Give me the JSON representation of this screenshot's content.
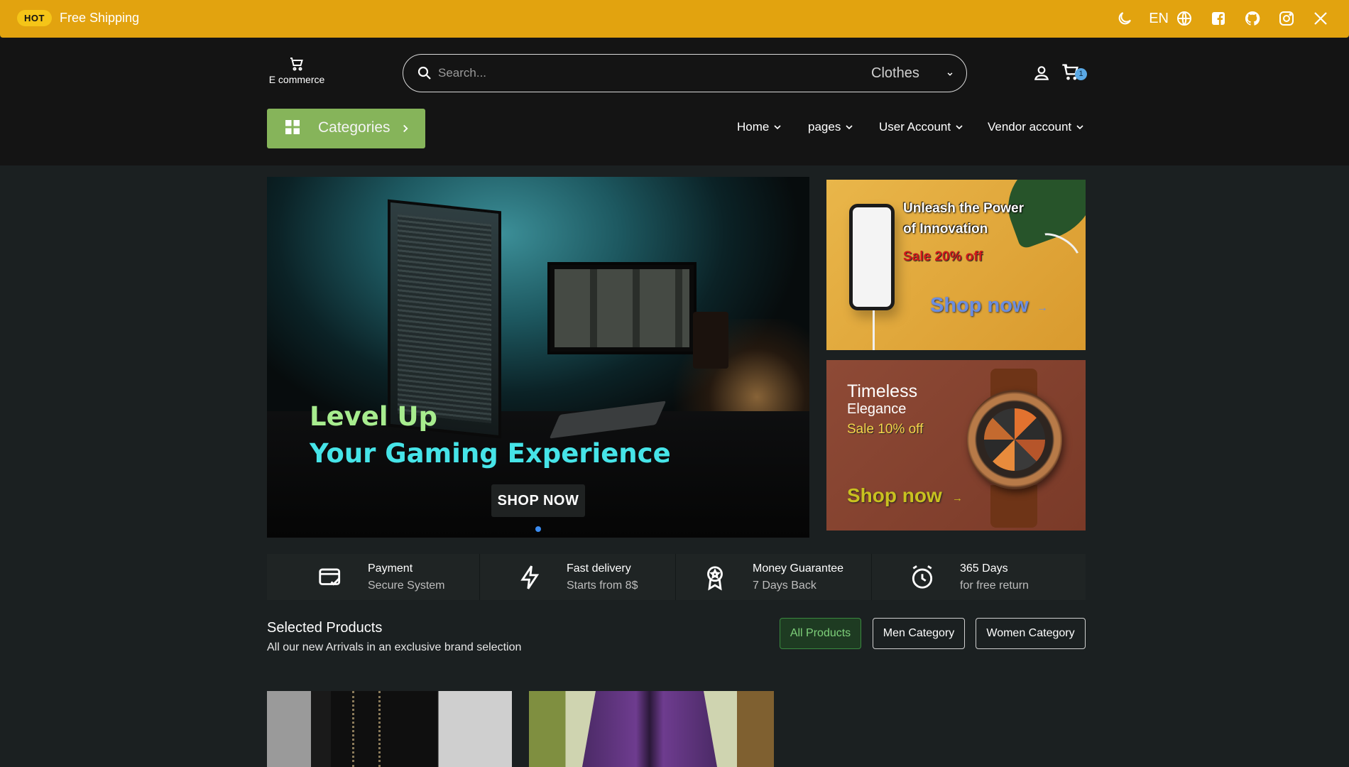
{
  "topbar": {
    "hot_badge": "HOT",
    "shipping_text": "Free Shipping",
    "language": "EN"
  },
  "header": {
    "logo_text": "E commerce",
    "search": {
      "placeholder": "Search...",
      "category": "Clothes"
    },
    "cart_count": "1",
    "categories_label": "Categories",
    "nav": [
      "Home",
      "pages",
      "User Account",
      "Vendor account"
    ]
  },
  "hero": {
    "line1": "Level Up",
    "line2": "Your Gaming Experience",
    "button": "SHOP NOW"
  },
  "promo1": {
    "title": "Unleash the Power of Innovation",
    "sale": "Sale 20% off",
    "shop": "Shop now",
    "arrow": "→"
  },
  "promo2": {
    "title": "Timeless",
    "subtitle": "Elegance",
    "sale": "Sale 10% off",
    "shop": "Shop now",
    "arrow": "→"
  },
  "features": [
    {
      "title": "Payment",
      "subtitle": "Secure System"
    },
    {
      "title": "Fast delivery",
      "subtitle": "Starts from 8$"
    },
    {
      "title": "Money Guarantee",
      "subtitle": "7 Days Back"
    },
    {
      "title": "365 Days",
      "subtitle": "for free return"
    }
  ],
  "selected": {
    "title": "Selected Products",
    "subtitle": "All our new Arrivals in an exclusive brand selection",
    "tabs": [
      "All Products",
      "Men Category",
      "Women Category"
    ]
  },
  "colors": {
    "topbar": "#e2a30f",
    "header": "#141414",
    "page": "#1b2021",
    "categories": "#86b45a",
    "active_tab": "#1e3b22"
  },
  "icons": [
    "moon-icon",
    "globe-icon",
    "facebook-icon",
    "github-icon",
    "instagram-icon",
    "x-icon",
    "cart-icon",
    "search-icon",
    "user-icon",
    "grid-icon",
    "card-check-icon",
    "bolt-icon",
    "award-icon",
    "alarm-icon"
  ]
}
